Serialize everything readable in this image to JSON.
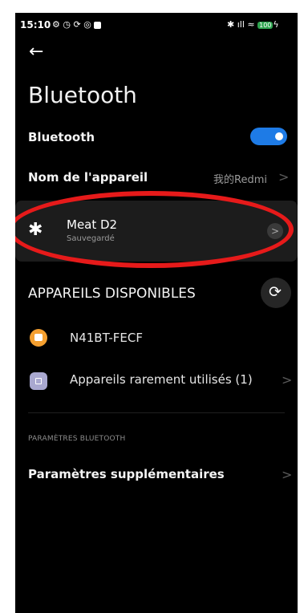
{
  "status_bar": {
    "time": "15:10",
    "left_icons": [
      "alarm-icon",
      "clock-icon",
      "sync-icon",
      "nfc-icon",
      "notification-icon"
    ],
    "right_icons": [
      "bluetooth-icon",
      "signal-icon",
      "wifi-icon",
      "battery-icon"
    ],
    "battery_level": "100"
  },
  "header": {
    "back_glyph": "←",
    "title": "Bluetooth"
  },
  "bluetooth_toggle": {
    "label": "Bluetooth",
    "on": true,
    "accent": "#1e7be6"
  },
  "device_name": {
    "label": "Nom de l'appareil",
    "value": "我的Redmi",
    "chevron": ">"
  },
  "saved_device": {
    "name": "Meat D2",
    "status": "Sauvegardé",
    "chevron": ">",
    "highlight_color": "#e61a1a"
  },
  "available": {
    "header": "APPAREILS DISPONIBLES",
    "devices": [
      {
        "name": "N41BT-FECF",
        "icon": "printer-icon",
        "icon_color": "#f5a030"
      }
    ],
    "rarely_used": {
      "label": "Appareils rarement utilisés (1)",
      "chevron": ">",
      "icon": "device-icon"
    }
  },
  "settings": {
    "section": "PARAMÈTRES BLUETOOTH",
    "extra": "Paramètres supplémentaires",
    "chevron": ">"
  }
}
